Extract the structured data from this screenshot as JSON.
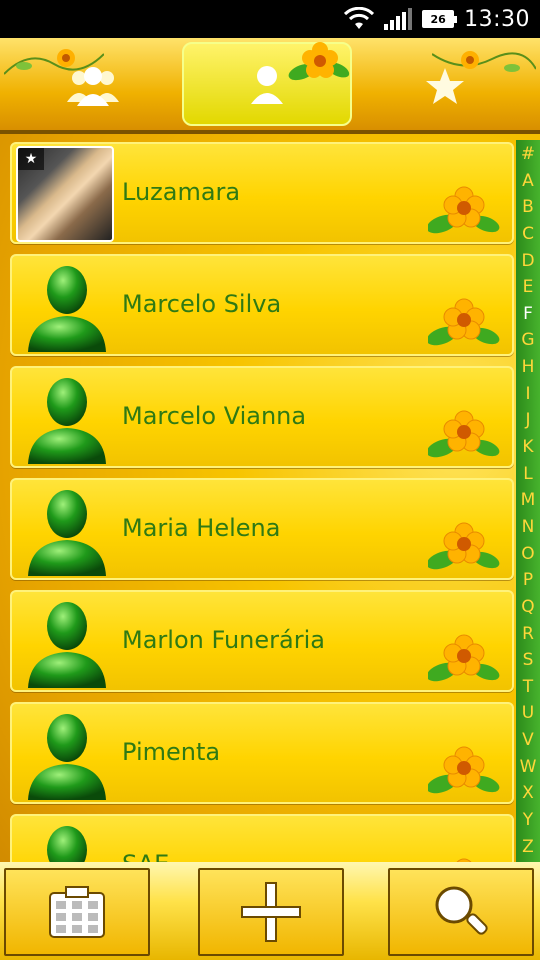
{
  "status_bar": {
    "time": "13:30",
    "battery_level": "26"
  },
  "tabs": [
    {
      "id": "groups",
      "icon": "people-icon",
      "active": false
    },
    {
      "id": "contacts",
      "icon": "person-icon",
      "active": true
    },
    {
      "id": "favorites",
      "icon": "star-icon",
      "active": false
    }
  ],
  "contacts": [
    {
      "name": "Luzamara",
      "has_photo": true,
      "starred": true
    },
    {
      "name": "Marcelo Silva",
      "has_photo": false
    },
    {
      "name": "Marcelo Vianna",
      "has_photo": false
    },
    {
      "name": "Maria Helena",
      "has_photo": false
    },
    {
      "name": "Marlon Funerária",
      "has_photo": false
    },
    {
      "name": "Pimenta",
      "has_photo": false
    },
    {
      "name": "SAE",
      "has_photo": false
    }
  ],
  "index_letters": [
    "#",
    "A",
    "B",
    "C",
    "D",
    "E",
    "F",
    "G",
    "H",
    "I",
    "J",
    "K",
    "L",
    "M",
    "N",
    "O",
    "P",
    "Q",
    "R",
    "S",
    "T",
    "U",
    "V",
    "W",
    "X",
    "Y",
    "Z"
  ],
  "index_current": "F",
  "bottom_bar": [
    {
      "id": "dialpad",
      "icon": "dialpad-icon"
    },
    {
      "id": "add",
      "icon": "plus-icon"
    },
    {
      "id": "search",
      "icon": "search-icon"
    }
  ],
  "colors": {
    "accent_green": "#2f7a14",
    "card_yellow": "#ffd400",
    "index_bg": "#3a9e24"
  }
}
